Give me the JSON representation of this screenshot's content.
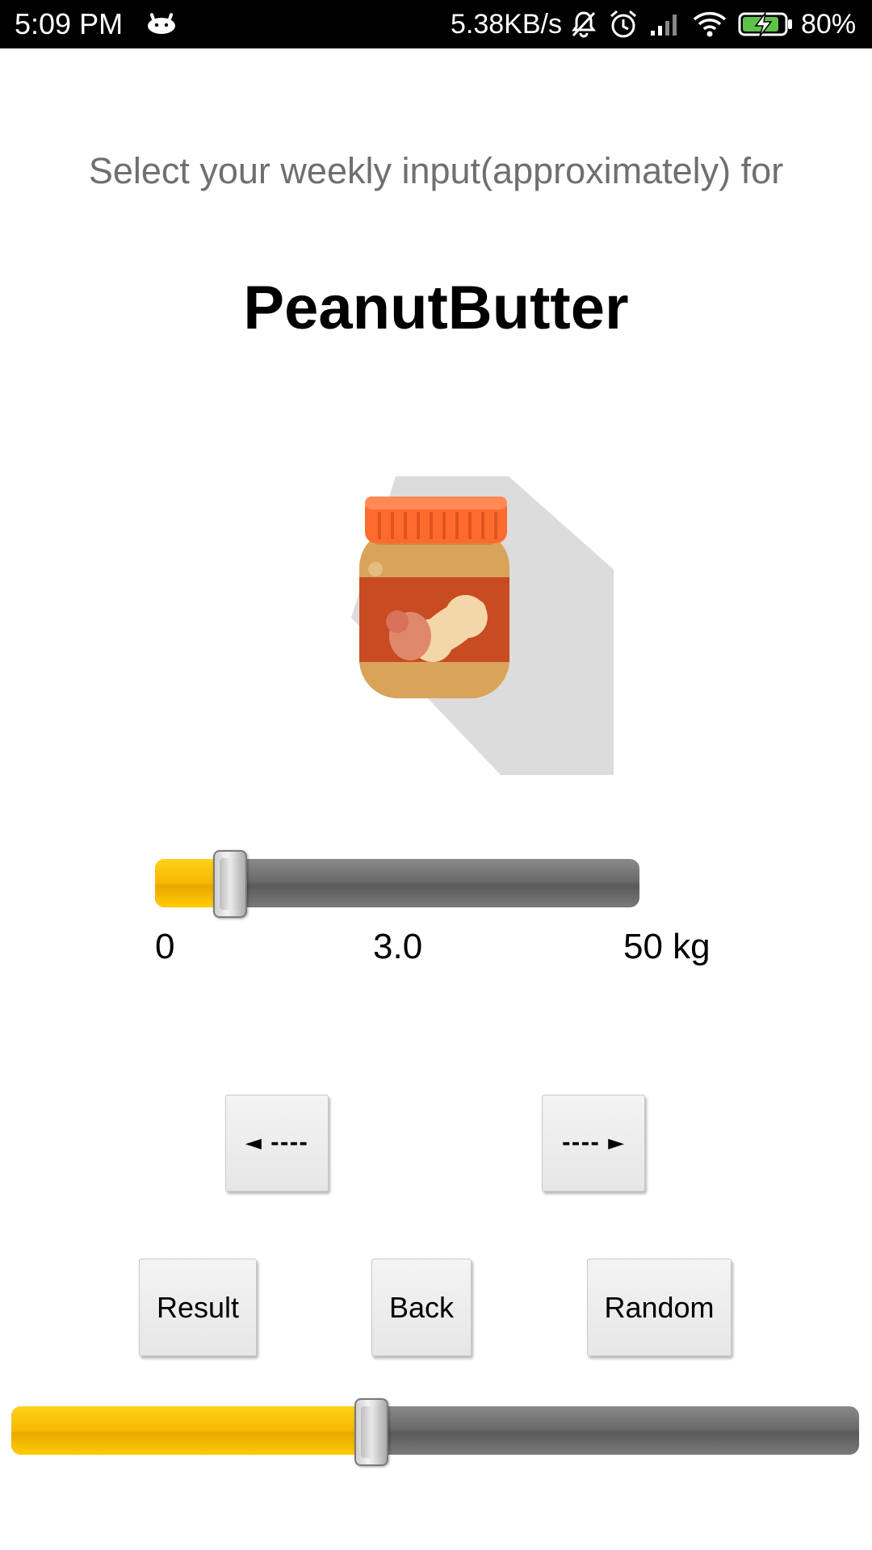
{
  "status_bar": {
    "time": "5:09 PM",
    "network_speed": "5.38KB/s",
    "battery_percent": "80%",
    "icons": [
      "android-icon",
      "mute-icon",
      "alarm-icon",
      "signal-icon",
      "wifi-icon",
      "battery-charging-icon"
    ]
  },
  "prompt": "Select your weekly input(approximately) for",
  "item_name": "PeanutButter",
  "image": {
    "icon": "peanut-butter-jar-icon"
  },
  "weight_slider": {
    "min_label": "0",
    "value_label": "3.0",
    "max_label": "50 kg",
    "min": 0,
    "max": 50,
    "value": 3.0
  },
  "nav": {
    "prev_label": "◄ ----",
    "next_label": "---- ►"
  },
  "actions": {
    "result_label": "Result",
    "back_label": "Back",
    "random_label": "Random"
  },
  "progress_slider": {
    "fraction": 0.425
  },
  "colors": {
    "accent": "#F6B800",
    "track": "#6B6B6B",
    "jar_lid": "#FF6B2E",
    "jar_label": "#C84B22",
    "jar_body": "#D9A35A"
  }
}
